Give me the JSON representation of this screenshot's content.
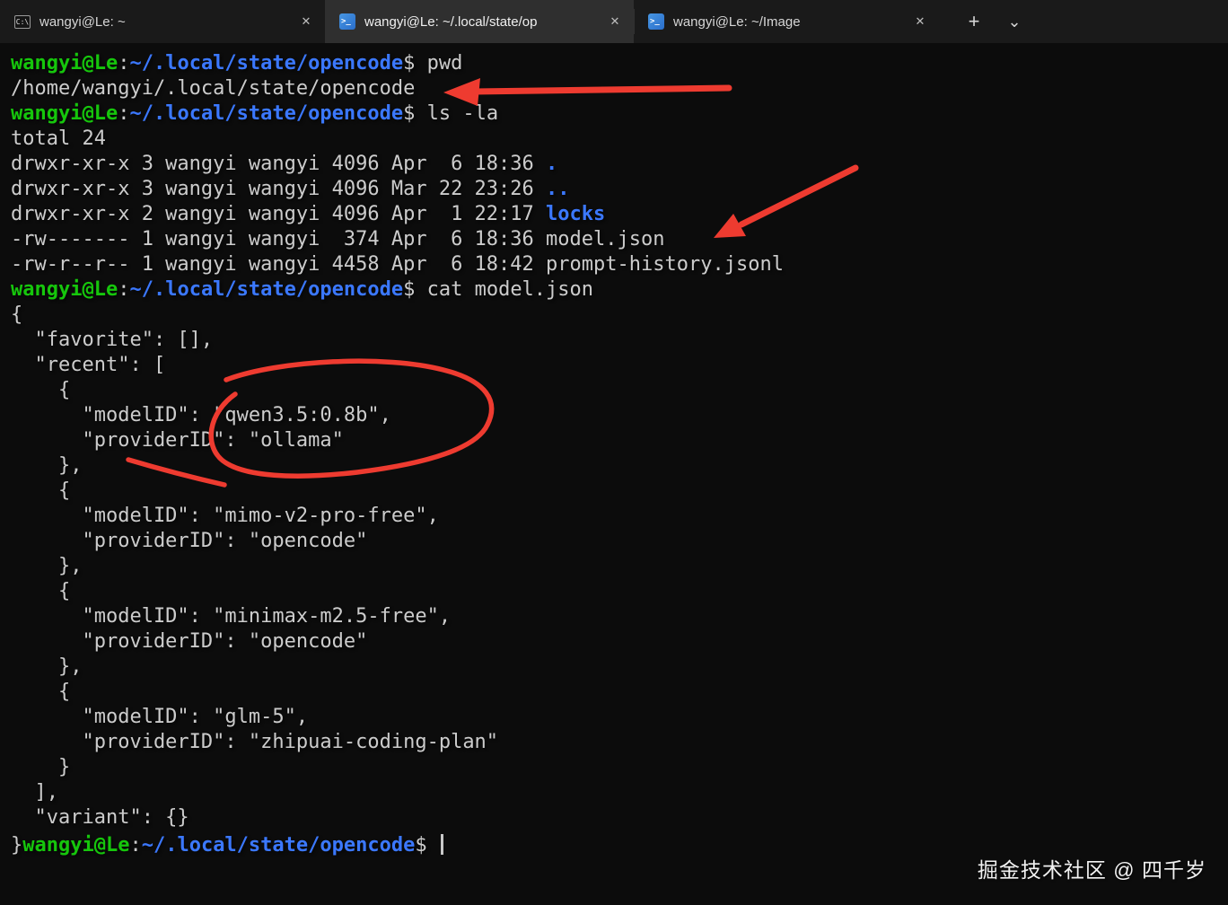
{
  "colors": {
    "terminal_bg": "#0c0c0c",
    "tabbar_bg": "#1a1a1a",
    "active_tab_bg": "#2f2f2f",
    "tab_fg": "#d6d6d6",
    "green": "#16c60c",
    "blue": "#3b78ff",
    "fg": "#cccccc",
    "red": "#ee3b30",
    "watermark_fg": "#f2f2f2"
  },
  "tabbar": {
    "tabs": [
      {
        "title": "wangyi@Le: ~"
      },
      {
        "title": "wangyi@Le: ~/.local/state/op"
      },
      {
        "title": "wangyi@Le: ~/Image"
      }
    ],
    "icons": {
      "cmd": "C:\\",
      "terminal": ">_"
    },
    "close_label": "✕",
    "new_tab_label": "+",
    "dropdown_label": "⌄"
  },
  "terminal": {
    "lines": [
      {
        "segments": [
          {
            "t": "wangyi@Le",
            "c": "green"
          },
          {
            "t": ":"
          },
          {
            "t": "~/.local/state/opencode",
            "c": "blue"
          },
          {
            "t": "$ pwd"
          }
        ]
      },
      {
        "segments": [
          {
            "t": "/home/wangyi/.local/state/opencode"
          }
        ]
      },
      {
        "segments": [
          {
            "t": "wangyi@Le",
            "c": "green"
          },
          {
            "t": ":"
          },
          {
            "t": "~/.local/state/opencode",
            "c": "blue"
          },
          {
            "t": "$ ls -la"
          }
        ]
      },
      {
        "segments": [
          {
            "t": "total 24"
          }
        ]
      },
      {
        "segments": [
          {
            "t": "drwxr-xr-x 3 wangyi wangyi 4096 Apr  6 18:36 "
          },
          {
            "t": ".",
            "c": "blue"
          }
        ]
      },
      {
        "segments": [
          {
            "t": "drwxr-xr-x 3 wangyi wangyi 4096 Mar 22 23:26 "
          },
          {
            "t": "..",
            "c": "blue"
          }
        ]
      },
      {
        "segments": [
          {
            "t": "drwxr-xr-x 2 wangyi wangyi 4096 Apr  1 22:17 "
          },
          {
            "t": "locks",
            "c": "blue"
          }
        ]
      },
      {
        "segments": [
          {
            "t": "-rw------- 1 wangyi wangyi  374 Apr  6 18:36 model.json"
          }
        ]
      },
      {
        "segments": [
          {
            "t": "-rw-r--r-- 1 wangyi wangyi 4458 Apr  6 18:42 prompt-history.jsonl"
          }
        ]
      },
      {
        "segments": [
          {
            "t": "wangyi@Le",
            "c": "green"
          },
          {
            "t": ":"
          },
          {
            "t": "~/.local/state/opencode",
            "c": "blue"
          },
          {
            "t": "$ cat model.json"
          }
        ]
      },
      {
        "segments": [
          {
            "t": "{"
          }
        ]
      },
      {
        "segments": [
          {
            "t": "  \"favorite\": [],"
          }
        ]
      },
      {
        "segments": [
          {
            "t": "  \"recent\": ["
          }
        ]
      },
      {
        "segments": [
          {
            "t": "    {"
          }
        ]
      },
      {
        "segments": [
          {
            "t": "      \"modelID\": \"qwen3.5:0.8b\","
          }
        ]
      },
      {
        "segments": [
          {
            "t": "      \"providerID\": \"ollama\""
          }
        ]
      },
      {
        "segments": [
          {
            "t": "    },"
          }
        ]
      },
      {
        "segments": [
          {
            "t": "    {"
          }
        ]
      },
      {
        "segments": [
          {
            "t": "      \"modelID\": \"mimo-v2-pro-free\","
          }
        ]
      },
      {
        "segments": [
          {
            "t": "      \"providerID\": \"opencode\""
          }
        ]
      },
      {
        "segments": [
          {
            "t": "    },"
          }
        ]
      },
      {
        "segments": [
          {
            "t": "    {"
          }
        ]
      },
      {
        "segments": [
          {
            "t": "      \"modelID\": \"minimax-m2.5-free\","
          }
        ]
      },
      {
        "segments": [
          {
            "t": "      \"providerID\": \"opencode\""
          }
        ]
      },
      {
        "segments": [
          {
            "t": "    },"
          }
        ]
      },
      {
        "segments": [
          {
            "t": "    {"
          }
        ]
      },
      {
        "segments": [
          {
            "t": "      \"modelID\": \"glm-5\","
          }
        ]
      },
      {
        "segments": [
          {
            "t": "      \"providerID\": \"zhipuai-coding-plan\""
          }
        ]
      },
      {
        "segments": [
          {
            "t": "    }"
          }
        ]
      },
      {
        "segments": [
          {
            "t": "  ],"
          }
        ]
      },
      {
        "segments": [
          {
            "t": "  \"variant\": {}"
          }
        ]
      },
      {
        "segments": [
          {
            "t": "}"
          },
          {
            "t": "wangyi@Le",
            "c": "green"
          },
          {
            "t": ":"
          },
          {
            "t": "~/.local/state/opencode",
            "c": "blue"
          },
          {
            "t": "$ "
          }
        ],
        "cursor": true
      }
    ]
  },
  "watermark": "掘金技术社区 @ 四千岁"
}
